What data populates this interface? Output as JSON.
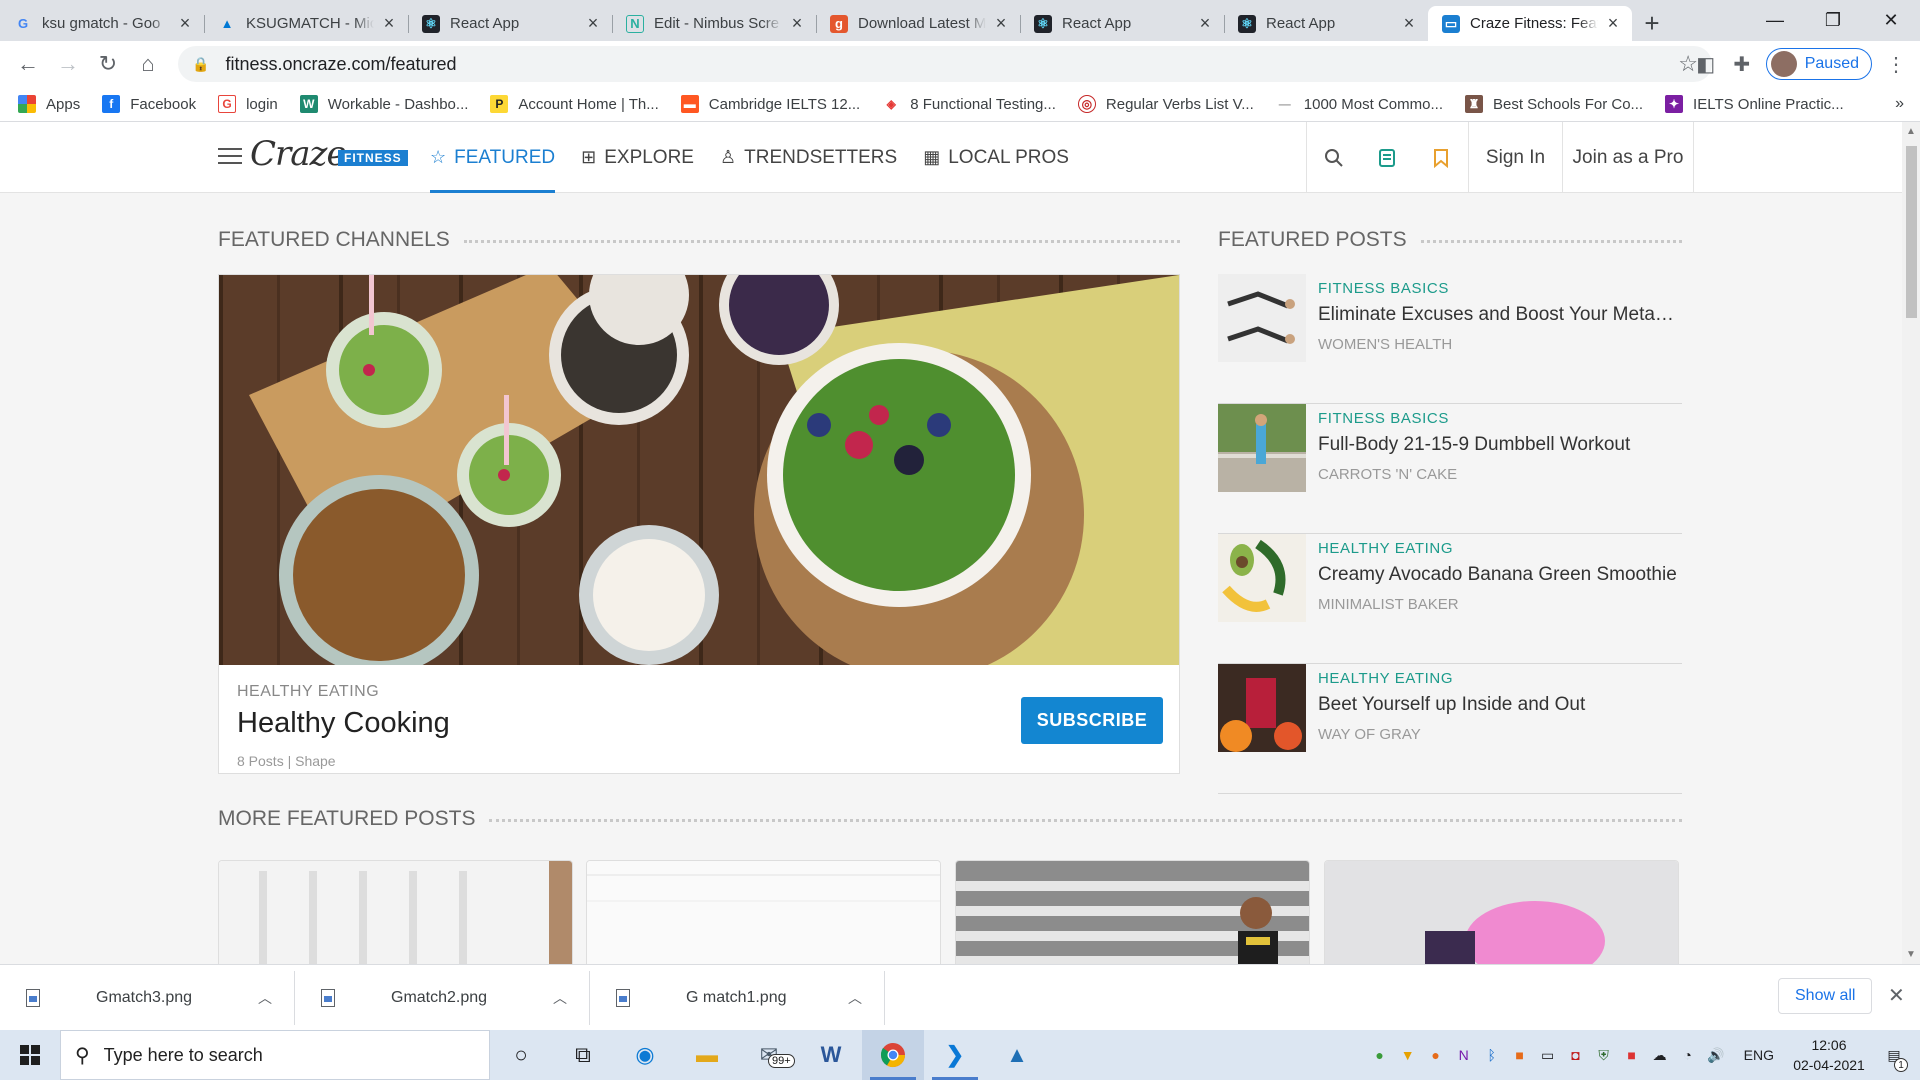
{
  "browser": {
    "tabs": [
      {
        "title": "ksu gmatch - Goo",
        "favicon": "google-g",
        "color": "#4285f4"
      },
      {
        "title": "KSUGMATCH - Mic",
        "favicon": "azure-a",
        "color": "#0078d4"
      },
      {
        "title": "React App",
        "favicon": "react-logo",
        "color": "#61dafb"
      },
      {
        "title": "Edit - Nimbus Scre",
        "favicon": "nimbus-n",
        "color": "#2ab0a0"
      },
      {
        "title": "Download Latest M",
        "favicon": "g-orange",
        "color": "#e4572e"
      },
      {
        "title": "React App",
        "favicon": "react-logo",
        "color": "#61dafb"
      },
      {
        "title": "React App",
        "favicon": "react-logo",
        "color": "#61dafb"
      },
      {
        "title": "Craze Fitness: Feat",
        "favicon": "craze-icon",
        "color": "#1b7fd1"
      }
    ],
    "url": "fitness.oncraze.com/featured",
    "profile_label": "Paused",
    "bookmarks": [
      {
        "label": "Apps",
        "color": "#ea4335"
      },
      {
        "label": "Facebook",
        "color": "#1877f2"
      },
      {
        "label": "login",
        "color": "#e8453c"
      },
      {
        "label": "Workable - Dashbo...",
        "color": "#1f8a70"
      },
      {
        "label": "Account Home | Th...",
        "color": "#222222"
      },
      {
        "label": "Cambridge IELTS 12...",
        "color": "#ff5722"
      },
      {
        "label": "8 Functional Testing...",
        "color": "#e53935"
      },
      {
        "label": "Regular Verbs List V...",
        "color": "#c62828"
      },
      {
        "label": "1000 Most Commo...",
        "color": "#9e9e9e"
      },
      {
        "label": "Best Schools For Co...",
        "color": "#795548"
      },
      {
        "label": "IELTS Online Practic...",
        "color": "#7b1fa2"
      }
    ]
  },
  "site": {
    "logo_text": "Craze",
    "logo_tag": "FITNESS",
    "nav": [
      {
        "label": "FEATURED",
        "icon": "star-icon",
        "active": true
      },
      {
        "label": "EXPLORE",
        "icon": "grid-icon",
        "active": false
      },
      {
        "label": "TRENDSETTERS",
        "icon": "person-icon",
        "active": false
      },
      {
        "label": "LOCAL PROS",
        "icon": "building-icon",
        "active": false
      }
    ],
    "sign_in": "Sign In",
    "join_pro": "Join as a Pro",
    "featured_channels_title": "FEATURED CHANNELS",
    "featured_posts_title": "FEATURED POSTS",
    "more_featured_title": "MORE FEATURED POSTS",
    "channel": {
      "category": "HEALTHY EATING",
      "title": "Healthy Cooking",
      "meta": "8 Posts | Shape",
      "subscribe_label": "SUBSCRIBE"
    },
    "posts": [
      {
        "category": "FITNESS BASICS",
        "title": "Eliminate Excuses and Boost Your Metab...",
        "source": "WOMEN'S HEALTH"
      },
      {
        "category": "FITNESS BASICS",
        "title": "Full-Body 21-15-9 Dumbbell Workout",
        "source": "CARROTS 'N' CAKE"
      },
      {
        "category": "HEALTHY EATING",
        "title": "Creamy Avocado Banana Green Smoothie",
        "source": "MINIMALIST BAKER"
      },
      {
        "category": "HEALTHY EATING",
        "title": "Beet Yourself up Inside and Out",
        "source": "WAY OF GRAY"
      }
    ]
  },
  "downloads": {
    "items": [
      "Gmatch3.png",
      "Gmatch2.png",
      "G match1.png"
    ],
    "show_all": "Show all"
  },
  "taskbar": {
    "search_placeholder": "Type here to search",
    "mail_badge": "99+",
    "lang": "ENG",
    "time": "12:06",
    "date": "02-04-2021",
    "notification_count": "1"
  }
}
